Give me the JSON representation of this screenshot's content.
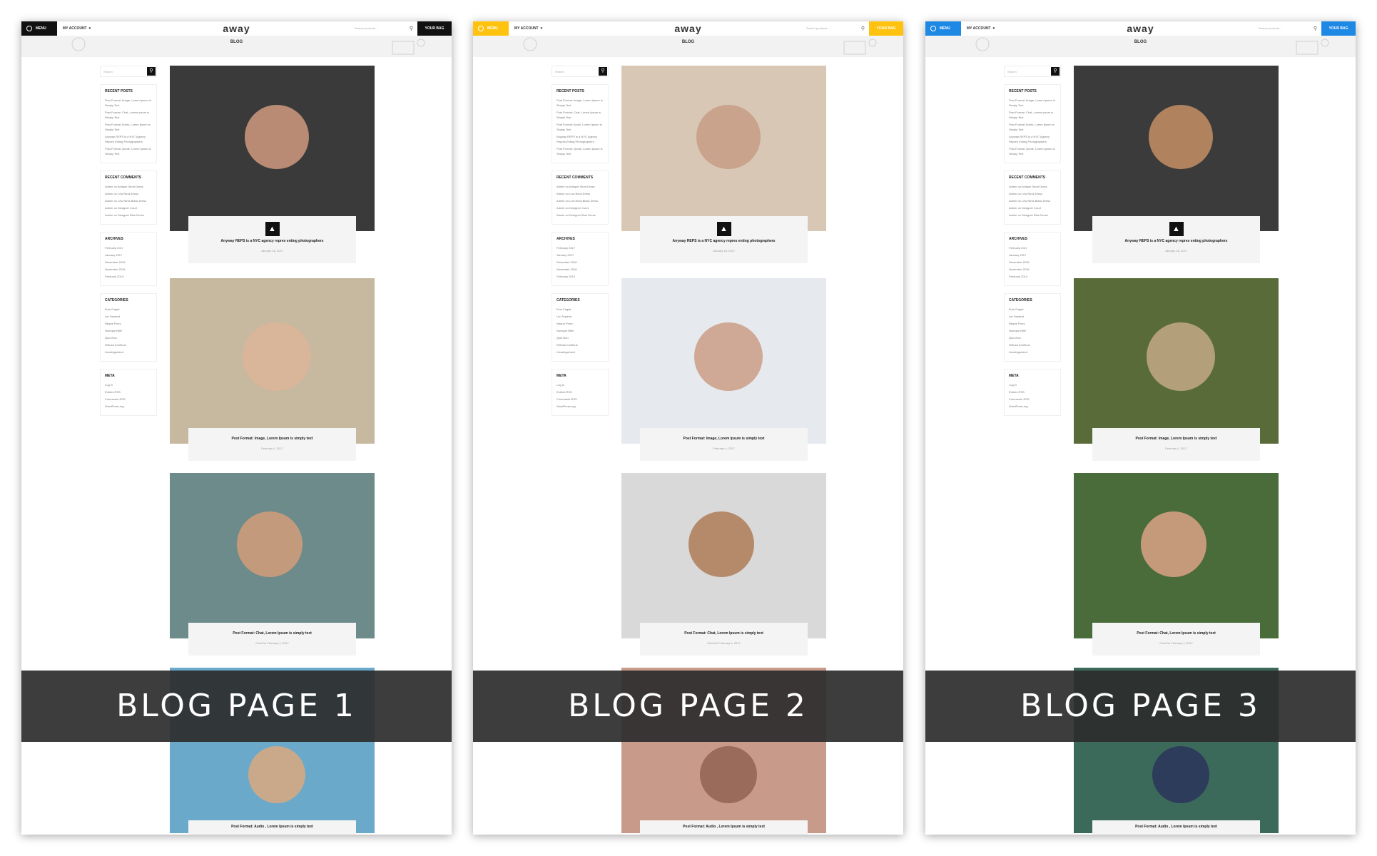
{
  "pages": [
    {
      "accent": "#111111",
      "menu_label": "MENU",
      "account_label": "MY ACCOUNT",
      "logo": "away",
      "search_placeholder": "Search products...",
      "bag_label": "YOUR BAG",
      "hero_title": "BLOG",
      "sidebar_search": "Search",
      "recent_posts_title": "RECENT POSTS",
      "recent_posts": [
        "Post Format: Image, Lorem Ipsum is Simply Text",
        "Post Format: Chat, Lorem Ipsum is Simply Text",
        "Post Format: Audio, Lorem Ipsum is Simply Text",
        "Anyway REPS is a NYC Agency Repres Enting Photographers",
        "Post Format: Quote, Lorem Ipsum is Simply Text"
      ],
      "recent_comments_title": "RECENT COMMENTS",
      "recent_comments": [
        "Admin on Antique Short Dress",
        "Admin on Low Neck Dress",
        "Admin on Low Neck Black Dress",
        "Admin on Designer Court",
        "Admin on Designer Blue Dress"
      ],
      "archives_title": "ARCHIVES",
      "archives": [
        "February 2017",
        "January 2017",
        "December 2016",
        "November 2016",
        "February 2014"
      ],
      "categories_title": "CATEGORIES",
      "categories": [
        "Eum Fugiat",
        "Ler Separat",
        "Neque Porro",
        "Numque Nihil",
        "Quis Non",
        "Refusa Continue",
        "Uncategorized"
      ],
      "meta_title": "META",
      "meta": [
        "Log in",
        "Entries RSS",
        "Comments RSS",
        "WordPress.org"
      ],
      "posts": [
        {
          "title": "Anyway REPS is a NYC agency repres enting photographers",
          "date": "January 18, 2017"
        },
        {
          "title": "Post Format: Image, Lorem Ipsum is simply text",
          "date": "February 4, 2017"
        },
        {
          "title": "Post Format: Chat, Lorem Ipsum is simply text",
          "date": "Chat On February 4, 2017"
        },
        {
          "title": "Post Format: Audio , Lorem Ipsum is simply text",
          "date": ""
        }
      ],
      "banner": "BLOG PAGE 1"
    },
    {
      "accent": "#ffc20e",
      "menu_label": "MENU",
      "account_label": "MY ACCOUNT",
      "logo": "away",
      "search_placeholder": "Search products...",
      "bag_label": "YOUR BAG",
      "hero_title": "BLOG",
      "sidebar_search": "Search",
      "recent_posts_title": "RECENT POSTS",
      "recent_posts": [
        "Post Format: Image, Lorem Ipsum is Simply Text",
        "Post Format: Chat, Lorem Ipsum is Simply Text",
        "Post Format: Audio, Lorem Ipsum is Simply Text",
        "Anyway REPS is a NYC Agency Repres Enting Photographers",
        "Post Format: Quote, Lorem Ipsum is Simply Text"
      ],
      "recent_comments_title": "RECENT COMMENTS",
      "recent_comments": [
        "Admin on Antique Short Dress",
        "Admin on Low Neck Dress",
        "Admin on Low Neck Black Dress",
        "Admin on Designer Court",
        "Admin on Designer Blue Dress"
      ],
      "archives_title": "ARCHIVES",
      "archives": [
        "February 2017",
        "January 2017",
        "December 2016",
        "November 2016",
        "February 2014"
      ],
      "categories_title": "CATEGORIES",
      "categories": [
        "Eum Fugiat",
        "Ler Separat",
        "Neque Porro",
        "Numque Nihil",
        "Quis Non",
        "Refusa Continue",
        "Uncategorized"
      ],
      "meta_title": "META",
      "meta": [
        "Log in",
        "Entries RSS",
        "Comments RSS",
        "WordPress.org"
      ],
      "posts": [
        {
          "title": "Anyway REPS is a NYC agency repres enting photographers",
          "date": "January 18, 2017"
        },
        {
          "title": "Post Format: Image, Lorem Ipsum is simply text",
          "date": "February 4, 2017"
        },
        {
          "title": "Post Format: Chat, Lorem Ipsum is simply text",
          "date": "Chat On February 4, 2017"
        },
        {
          "title": "Post Format: Audio , Lorem Ipsum is simply text",
          "date": ""
        }
      ],
      "banner": "BLOG PAGE 2"
    },
    {
      "accent": "#1e88e5",
      "menu_label": "MENU",
      "account_label": "MY ACCOUNT",
      "logo": "away",
      "search_placeholder": "Search products...",
      "bag_label": "YOUR BAG",
      "hero_title": "BLOG",
      "sidebar_search": "Search",
      "recent_posts_title": "RECENT POSTS",
      "recent_posts": [
        "Post Format: Image, Lorem Ipsum is Simply Text",
        "Post Format: Chat, Lorem Ipsum is Simply Text",
        "Post Format: Audio, Lorem Ipsum is Simply Text",
        "Anyway REPS is a NYC Agency Repres Enting Photographers",
        "Post Format: Quote, Lorem Ipsum is Simply Text"
      ],
      "recent_comments_title": "RECENT COMMENTS",
      "recent_comments": [
        "Admin on Antique Short Dress",
        "Admin on Low Neck Dress",
        "Admin on Low Neck Black Dress",
        "Admin on Designer Court",
        "Admin on Designer Blue Dress"
      ],
      "archives_title": "ARCHIVES",
      "archives": [
        "February 2017",
        "January 2017",
        "December 2016",
        "November 2016",
        "February 2014"
      ],
      "categories_title": "CATEGORIES",
      "categories": [
        "Eum Fugiat",
        "Ler Separat",
        "Neque Porro",
        "Numque Nihil",
        "Quis Non",
        "Refusa Continue",
        "Uncategorized"
      ],
      "meta_title": "META",
      "meta": [
        "Log in",
        "Entries RSS",
        "Comments RSS",
        "WordPress.org"
      ],
      "posts": [
        {
          "title": "Anyway REPS is a NYC agency repres enting photographers",
          "date": "January 18, 2017"
        },
        {
          "title": "Post Format: Image, Lorem Ipsum is simply text",
          "date": "February 4, 2017"
        },
        {
          "title": "Post Format: Chat, Lorem Ipsum is simply text",
          "date": "Chat On February 4, 2017"
        },
        {
          "title": "Post Format: Audio , Lorem Ipsum is simply text",
          "date": ""
        }
      ],
      "banner": "BLOG PAGE 3"
    }
  ]
}
